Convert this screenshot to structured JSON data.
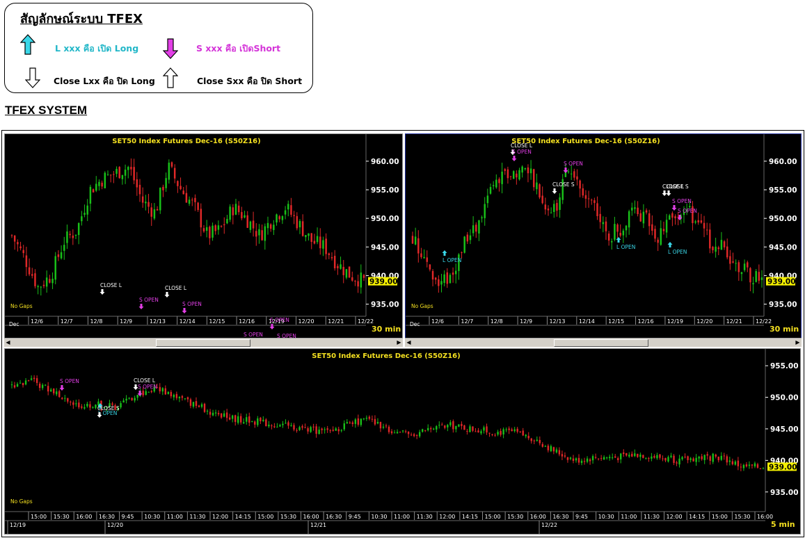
{
  "legend": {
    "title": "สัญลักษณ์ระบบ TFEX",
    "items": [
      {
        "icon": "cyan-up-arrow-icon",
        "text": "L xxx คือ เปิด Long",
        "color": "#22b7c8"
      },
      {
        "icon": "magenta-down-arrow-icon",
        "text": "S xxx คือ เปิดShort",
        "color": "#d434d8"
      },
      {
        "icon": "white-down-arrow-icon",
        "text": "Close Lxx คือ ปิด Long",
        "color": "#000000"
      },
      {
        "icon": "white-up-arrow-icon",
        "text": "Close Sxx คือ ปิด Short",
        "color": "#000000"
      }
    ]
  },
  "section_title": "TFEX SYSTEM",
  "colors": {
    "up": "#19c019",
    "down": "#e02828",
    "title": "#f4e020",
    "axis": "#ffffff",
    "open_long": "#3ad7e8",
    "open_short": "#e23fe6",
    "close": "#ffffff",
    "price_tag": "#f4f000"
  },
  "panels": [
    {
      "id": "left",
      "title": "SET50  Index  Futures  Dec-16  (S50Z16)",
      "y_ticks": [
        "960.00",
        "955.00",
        "950.00",
        "945.00",
        "940.00",
        "935.00"
      ],
      "last_price": "939.00",
      "timeframe": "30  min",
      "gaps_label": "No  Gaps",
      "x_ticks": [
        "12/6",
        "12/7",
        "12/8",
        "12/9",
        "12/13",
        "12/14",
        "12/15",
        "12/16",
        "12/19",
        "12/20",
        "12/21",
        "12/22"
      ],
      "x_sub_label": "Dec",
      "signals": [
        {
          "text": "S  OPEN",
          "type": "short"
        },
        {
          "text": "CLOSE  S",
          "type": "close"
        },
        {
          "text": "L  OPEN",
          "type": "long"
        },
        {
          "text": "CLOSE  L",
          "type": "close"
        },
        {
          "text": "S  OPEN",
          "type": "short"
        },
        {
          "text": "CLOSE  L",
          "type": "close"
        },
        {
          "text": "S  OPEN",
          "type": "short"
        },
        {
          "text": "L  OPEN",
          "type": "long"
        },
        {
          "text": "CLOSE  S",
          "type": "close"
        },
        {
          "text": "S  OPEN",
          "type": "short"
        },
        {
          "text": "S  OPEN",
          "type": "short"
        },
        {
          "text": "S  OPEN",
          "type": "short"
        },
        {
          "text": "L  OPEN",
          "type": "long"
        },
        {
          "text": "CLOSE  S",
          "type": "close"
        }
      ]
    },
    {
      "id": "right",
      "title": "SET50  Index  Futures  Dec-16  (S50Z16)",
      "y_ticks": [
        "960.00",
        "955.00",
        "950.00",
        "945.00",
        "940.00",
        "935.00"
      ],
      "last_price": "939.00",
      "timeframe": "30  min",
      "gaps_label": "No  Gaps",
      "x_ticks": [
        "12/6",
        "12/7",
        "12/8",
        "12/9",
        "12/13",
        "12/14",
        "12/15",
        "12/16",
        "12/19",
        "12/20",
        "12/21",
        "12/22"
      ],
      "x_sub_label": "Dec",
      "signals": [
        {
          "text": "CLOSE  L",
          "type": "close"
        },
        {
          "text": "S  OPEN",
          "type": "short"
        },
        {
          "text": "S  OPEN",
          "type": "short"
        },
        {
          "text": "CLOSE  S",
          "type": "close"
        },
        {
          "text": "L  OPEN",
          "type": "long"
        },
        {
          "text": "L  OPEN",
          "type": "long"
        },
        {
          "text": "CLOSE  L",
          "type": "close"
        },
        {
          "text": "CLOSE  S",
          "type": "close"
        },
        {
          "text": "S  OPEN",
          "type": "short"
        },
        {
          "text": "S  OPEN",
          "type": "short"
        },
        {
          "text": "L  OPEN",
          "type": "long"
        }
      ]
    },
    {
      "id": "bottom",
      "title": "SET50  Index  Futures  Dec-16  (S50Z16)",
      "y_ticks": [
        "955.00",
        "950.00",
        "945.00",
        "940.00",
        "935.00"
      ],
      "last_price": "939.00",
      "timeframe": "5  min",
      "gaps_label": "No  Gaps",
      "x_ticks": [
        "15:00",
        "15:30",
        "16:00",
        "16:30",
        "9:45",
        "10:30",
        "11:00",
        "11:30",
        "12:00",
        "14:15",
        "15:00",
        "15:30",
        "16:00",
        "16:30",
        "9:45",
        "10:30",
        "11:00",
        "11:30",
        "12:00",
        "14:15",
        "15:00",
        "15:30",
        "16:00",
        "16:30",
        "9:45",
        "10:30",
        "11:00",
        "11:30",
        "12:00",
        "14:15",
        "15:00",
        "15:30",
        "16:00"
      ],
      "date_labels": [
        "12/19",
        "12/20",
        "12/21",
        "12/22"
      ],
      "signals": [
        {
          "text": "S  OPEN",
          "type": "short"
        },
        {
          "text": "L  OPEN",
          "type": "long"
        },
        {
          "text": "CLOSE  S",
          "type": "close"
        },
        {
          "text": "CLOSE  L",
          "type": "close"
        },
        {
          "text": "S  OPEN",
          "type": "short"
        }
      ]
    }
  ],
  "chart_data": [
    {
      "type": "candlestick",
      "title": "SET50  Index  Futures  Dec-16  (S50Z16)",
      "timeframe": "30  min",
      "ylim": [
        933,
        964
      ],
      "x": [
        "12/6",
        "12/7",
        "12/8",
        "12/9",
        "12/13",
        "12/14",
        "12/15",
        "12/16",
        "12/19",
        "12/20",
        "12/21",
        "12/22"
      ],
      "close_path": [
        947,
        943,
        938,
        940,
        946,
        948,
        955,
        957,
        958,
        959,
        953,
        951,
        959,
        955,
        952,
        947,
        948,
        952,
        950,
        947,
        950,
        952,
        949,
        946,
        945,
        942,
        940,
        939
      ],
      "last": 939.0
    },
    {
      "type": "candlestick",
      "title": "SET50  Index  Futures  Dec-16  (S50Z16)",
      "timeframe": "30  min",
      "ylim": [
        933,
        964
      ],
      "x": [
        "12/6",
        "12/7",
        "12/8",
        "12/9",
        "12/13",
        "12/14",
        "12/15",
        "12/16",
        "12/19",
        "12/20",
        "12/21",
        "12/22"
      ],
      "close_path": [
        947,
        943,
        938,
        940,
        946,
        948,
        955,
        957,
        958,
        959,
        953,
        951,
        959,
        955,
        952,
        947,
        948,
        952,
        950,
        947,
        950,
        952,
        949,
        946,
        945,
        942,
        940,
        939
      ],
      "last": 939.0
    },
    {
      "type": "candlestick",
      "title": "SET50  Index  Futures  Dec-16  (S50Z16)",
      "timeframe": "5  min",
      "ylim": [
        932,
        957
      ],
      "close_path": [
        952,
        952.5,
        951,
        948.5,
        949,
        948.5,
        950.5,
        951.5,
        950,
        948.5,
        947,
        946.5,
        946,
        945.5,
        945,
        944.5,
        945.5,
        946.5,
        945,
        944,
        945,
        945.5,
        945,
        944.5,
        944.5,
        943.5,
        941.5,
        940,
        940.5,
        940.5,
        941,
        940.5,
        940,
        940.5,
        940.5,
        939,
        939
      ],
      "last": 939.0
    }
  ]
}
